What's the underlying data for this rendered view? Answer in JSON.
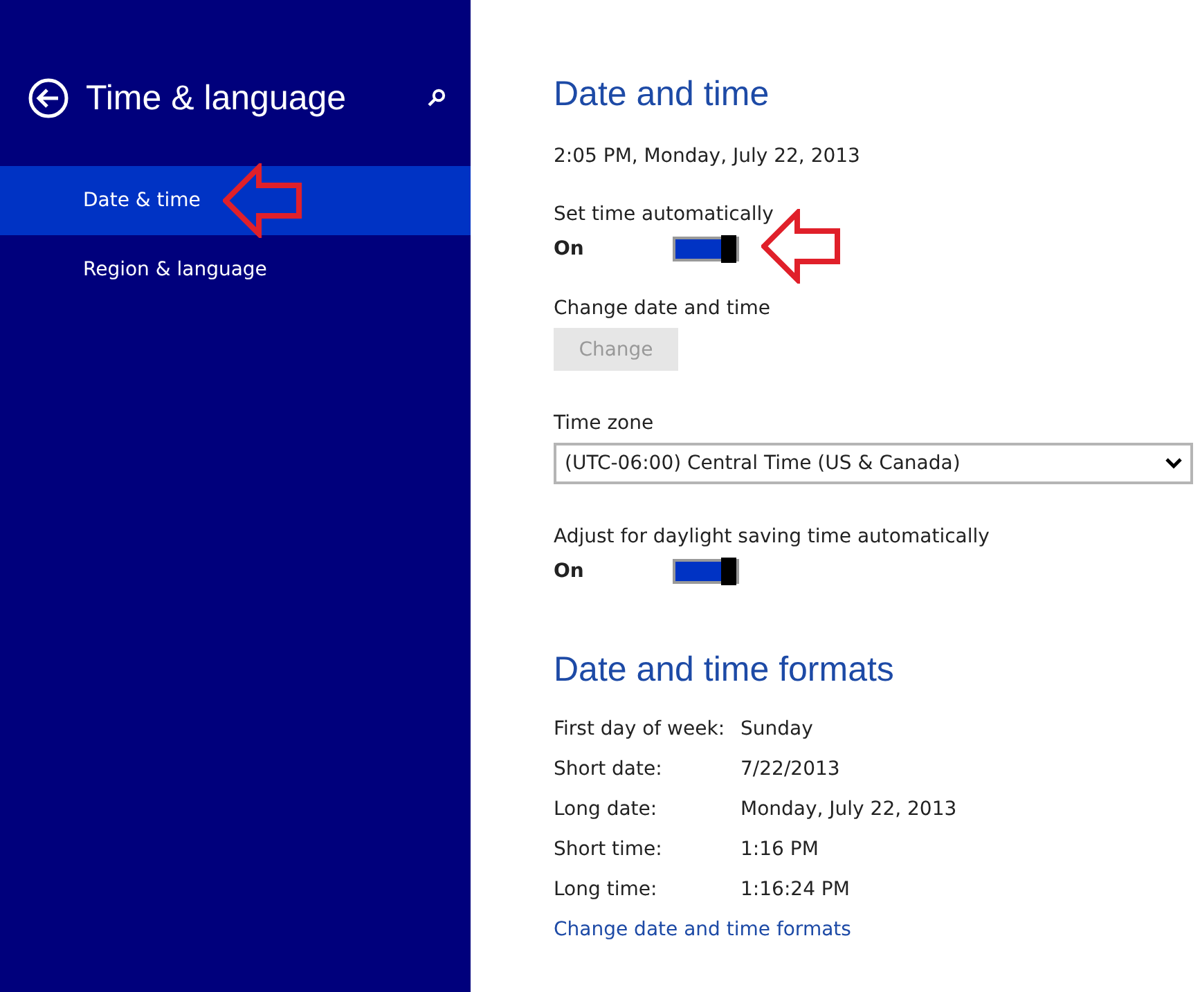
{
  "sidebar": {
    "title": "Time & language",
    "items": [
      {
        "label": "Date & time",
        "selected": true,
        "pointer": true
      },
      {
        "label": "Region & language",
        "selected": false,
        "pointer": false
      }
    ]
  },
  "main": {
    "heading": "Date and time",
    "current": "2:05 PM, Monday, July 22, 2013",
    "auto_time": {
      "label": "Set time automatically",
      "state": "On",
      "on": true,
      "pointer": true
    },
    "change": {
      "label": "Change date and time",
      "button": "Change",
      "disabled": true
    },
    "time_zone": {
      "label": "Time zone",
      "value": "(UTC-06:00) Central Time (US & Canada)"
    },
    "daylight": {
      "label": "Adjust for daylight saving time automatically",
      "state": "On",
      "on": true,
      "pointer": false
    },
    "formats_heading": "Date and time formats",
    "formats": [
      {
        "label": "First day of week:",
        "value": "Sunday"
      },
      {
        "label": "Short date:",
        "value": "7/22/2013"
      },
      {
        "label": "Long date:",
        "value": "Monday, July 22, 2013"
      },
      {
        "label": "Short time:",
        "value": "1:16 PM"
      },
      {
        "label": "Long time:",
        "value": "1:16:24 PM"
      }
    ],
    "link": "Change date and time formats"
  }
}
